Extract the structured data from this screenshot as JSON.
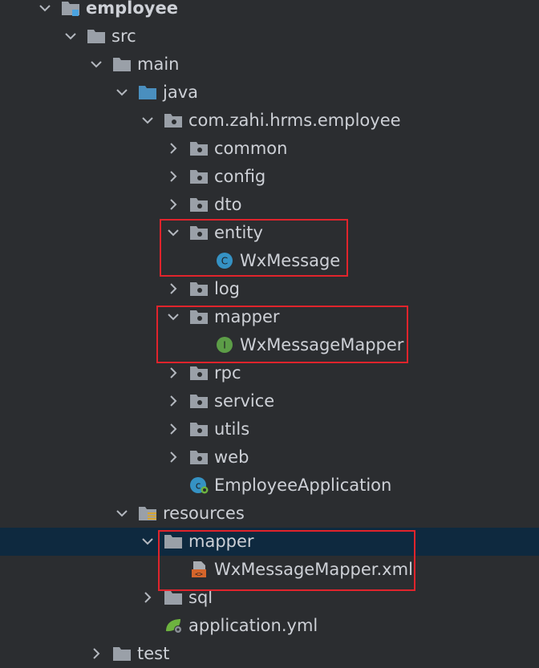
{
  "colors": {
    "background": "#2b2d30",
    "selected_row": "#0e293f",
    "text": "#cdd0d6",
    "folder": "#9aa0a8",
    "source_root": "#4a8fbf",
    "class_badge": "#3592c4",
    "interface_badge": "#5c9d47",
    "highlight_box": "#e0242c"
  },
  "tree": [
    {
      "label": "employee",
      "icon": "module-folder-icon",
      "expanded": true,
      "bold": true
    },
    {
      "label": "src",
      "icon": "folder-icon",
      "expanded": true
    },
    {
      "label": "main",
      "icon": "folder-icon",
      "expanded": true
    },
    {
      "label": "java",
      "icon": "source-root-folder-icon",
      "expanded": true
    },
    {
      "label": "com.zahi.hrms.employee",
      "icon": "package-icon",
      "expanded": true
    },
    {
      "label": "common",
      "icon": "package-icon",
      "expanded": false
    },
    {
      "label": "config",
      "icon": "package-icon",
      "expanded": false
    },
    {
      "label": "dto",
      "icon": "package-icon",
      "expanded": false
    },
    {
      "label": "entity",
      "icon": "package-icon",
      "expanded": true
    },
    {
      "label": "WxMessage",
      "icon": "class-icon",
      "badge": "C"
    },
    {
      "label": "log",
      "icon": "package-icon",
      "expanded": false
    },
    {
      "label": "mapper",
      "icon": "package-icon",
      "expanded": true
    },
    {
      "label": "WxMessageMapper",
      "icon": "interface-icon",
      "badge": "I"
    },
    {
      "label": "rpc",
      "icon": "package-icon",
      "expanded": false
    },
    {
      "label": "service",
      "icon": "package-icon",
      "expanded": false
    },
    {
      "label": "utils",
      "icon": "package-icon",
      "expanded": false
    },
    {
      "label": "web",
      "icon": "package-icon",
      "expanded": false
    },
    {
      "label": "EmployeeApplication",
      "icon": "spring-boot-class-icon"
    },
    {
      "label": "resources",
      "icon": "resources-folder-icon",
      "expanded": true
    },
    {
      "label": "mapper",
      "icon": "folder-icon",
      "expanded": true,
      "selected": true
    },
    {
      "label": "WxMessageMapper.xml",
      "icon": "xml-file-icon"
    },
    {
      "label": "sql",
      "icon": "folder-icon",
      "expanded": false
    },
    {
      "label": "application.yml",
      "icon": "spring-yaml-icon"
    },
    {
      "label": "test",
      "icon": "folder-icon",
      "expanded": false
    }
  ]
}
